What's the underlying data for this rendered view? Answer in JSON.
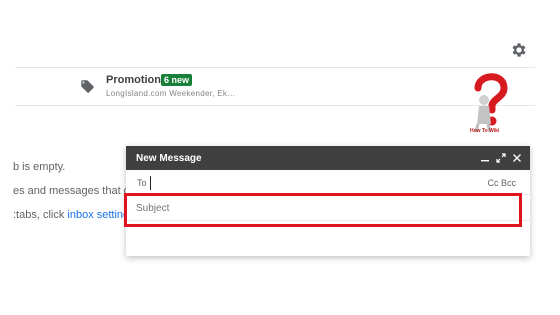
{
  "promotions": {
    "title": "Promotions",
    "badge": "6 new",
    "sender_preview": "LongIsland.com Weekender, Ek…"
  },
  "watermark": {
    "text": "How To Wiki"
  },
  "empty_state": {
    "line1": "b is empty.",
    "line2": "es and messages that do",
    "line3_prefix": ":tabs, click ",
    "line3_link": "inbox settings"
  },
  "compose": {
    "title": "New Message",
    "to_label": "To",
    "to_value": "",
    "cc_bcc_label": "Cc Bcc",
    "subject_placeholder": "Subject",
    "subject_value": ""
  },
  "icons": {
    "settings": "gear-icon",
    "category": "tag-icon",
    "minimize": "minimize-icon",
    "expand": "expand-icon",
    "close": "close-icon"
  },
  "colors": {
    "badge_green": "#188038",
    "compose_header": "#404040",
    "highlight_red": "#e0141e",
    "link_blue": "#1a73e8"
  }
}
